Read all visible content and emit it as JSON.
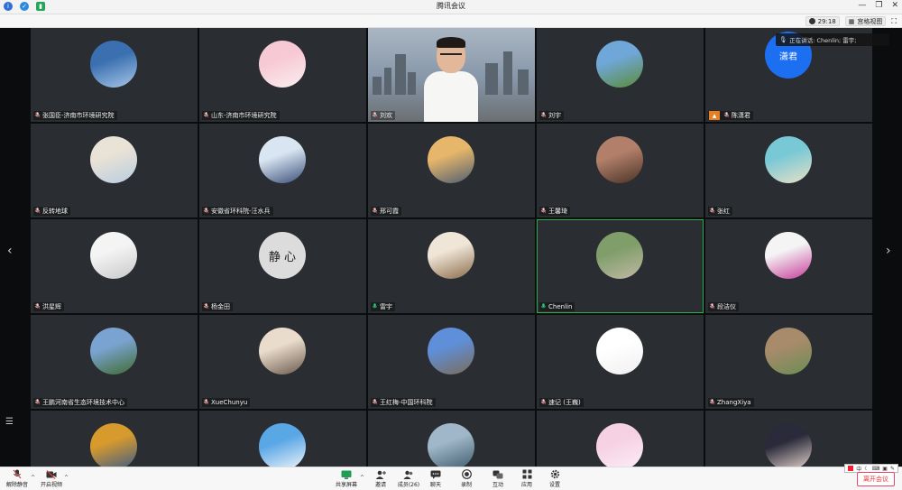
{
  "window": {
    "title": "腾讯会议"
  },
  "topbar": {
    "timer": "29:18",
    "view_mode": "宫格视图"
  },
  "speaking": {
    "label": "正在讲话: Chenlin; 雷宇;"
  },
  "participants": [
    {
      "name": "张国臣-济南市环境研究院",
      "avatar": "landscape-avatar",
      "colors": [
        "#3a6fb0",
        "#a7c6e8"
      ]
    },
    {
      "name": "山东-济南市环境研究院",
      "avatar": "cartoon-girl-avatar",
      "colors": [
        "#f7c9d4",
        "#fbeef1"
      ]
    },
    {
      "name": "刘欢",
      "avatar": "video",
      "colors": [
        "#aab6c3",
        "#6b6f72"
      ]
    },
    {
      "name": "刘宇",
      "avatar": "sky-landscape-avatar",
      "colors": [
        "#6fa7d8",
        "#5c8b3a"
      ]
    },
    {
      "name": "陈潇君",
      "avatar": "name-avatar",
      "initials": "潇君",
      "colors": [
        "#1d6ff2",
        "#1d6ff2"
      ]
    },
    {
      "name": "反转地球",
      "avatar": "person-avatar",
      "colors": [
        "#e9e2d6",
        "#b9cde0"
      ]
    },
    {
      "name": "安徽省环科院-汪水兵",
      "avatar": "snow-avatar",
      "colors": [
        "#d9e6f2",
        "#3b4f7a"
      ]
    },
    {
      "name": "邢可霞",
      "avatar": "mountain-avatar",
      "colors": [
        "#e6b66a",
        "#4f5e72"
      ]
    },
    {
      "name": "王馨琦",
      "avatar": "girl-photo-avatar",
      "colors": [
        "#b2806a",
        "#4a3226"
      ]
    },
    {
      "name": "张红",
      "avatar": "plush-toy-avatar",
      "colors": [
        "#78c8d6",
        "#e9e0c6"
      ]
    },
    {
      "name": "洪星辉",
      "avatar": "baby-avatar",
      "colors": [
        "#f4f4f4",
        "#c9c9c9"
      ]
    },
    {
      "name": "杨金田",
      "avatar": "calligraphy-avatar",
      "calligraphy": "静 心",
      "colors": [
        "#dcdcdc",
        "#dcdcdc"
      ]
    },
    {
      "name": "雷宇",
      "avatar": "child-mask-avatar",
      "colors": [
        "#f0e6d8",
        "#8a6b4a"
      ]
    },
    {
      "name": "Chenlin",
      "avatar": "outdoor-avatar",
      "colors": [
        "#7f9e6a",
        "#c2b8a5"
      ]
    },
    {
      "name": "段洁仪",
      "avatar": "flower-avatar",
      "colors": [
        "#f4f4f4",
        "#c83c9a"
      ]
    },
    {
      "name": "王鹏河南省生态环境技术中心",
      "avatar": "trees-avatar",
      "colors": [
        "#7aa3d1",
        "#3f6b2f"
      ]
    },
    {
      "name": "XueChunyu",
      "avatar": "men-photo-avatar",
      "colors": [
        "#e9dccc",
        "#6c5a4c"
      ]
    },
    {
      "name": "王红梅-中国环科院",
      "avatar": "flags-avatar",
      "colors": [
        "#5f8fd8",
        "#7a6c5a"
      ]
    },
    {
      "name": "速记 (王巍)",
      "avatar": "cartoon-face-avatar",
      "colors": [
        "#ffffff",
        "#f0f0f0"
      ]
    },
    {
      "name": "ZhangXiya",
      "avatar": "field-girl-avatar",
      "colors": [
        "#a78b6a",
        "#6b8c55"
      ]
    },
    {
      "name": "",
      "avatar": "feather-avatar",
      "colors": [
        "#d79a2c",
        "#3a5a8a"
      ]
    },
    {
      "name": "",
      "avatar": "penguin-avatar",
      "colors": [
        "#5aa7e6",
        "#f2f6fa"
      ]
    },
    {
      "name": "",
      "avatar": "clouds-avatar",
      "colors": [
        "#9fb7c8",
        "#3e5a6e"
      ]
    },
    {
      "name": "",
      "avatar": "anime-avatar",
      "colors": [
        "#f6d1e4",
        "#fbeef5"
      ]
    },
    {
      "name": "",
      "avatar": "dark-girl-avatar",
      "colors": [
        "#2a2a3a",
        "#e9d8d0"
      ]
    }
  ],
  "toolbar": {
    "unmute": "解除静音",
    "start_video": "开启视频",
    "share_screen": "共享屏幕",
    "invite": "邀请",
    "members": "成员(26)",
    "chat": "聊天",
    "record": "录制",
    "interact": "互动",
    "apps": "应用",
    "settings": "设置",
    "leave": "离开会议"
  },
  "ime": {
    "label": "中"
  }
}
